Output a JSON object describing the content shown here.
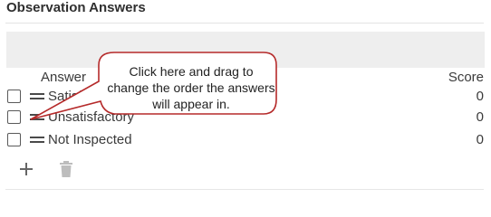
{
  "section": {
    "title": "Observation Answers"
  },
  "table": {
    "columns": {
      "answer": "Answer",
      "score": "Score"
    },
    "rows": [
      {
        "answer": "Satisfactory",
        "score": "0"
      },
      {
        "answer": "Unsatisfactory",
        "score": "0"
      },
      {
        "answer": "Not Inspected",
        "score": "0"
      }
    ]
  },
  "toolbar": {
    "add_icon": "plus-icon",
    "delete_icon": "trash-icon"
  },
  "callout": {
    "text": "Click here and drag to change the order the answers will appear in.",
    "border_color": "#b52a2a"
  }
}
